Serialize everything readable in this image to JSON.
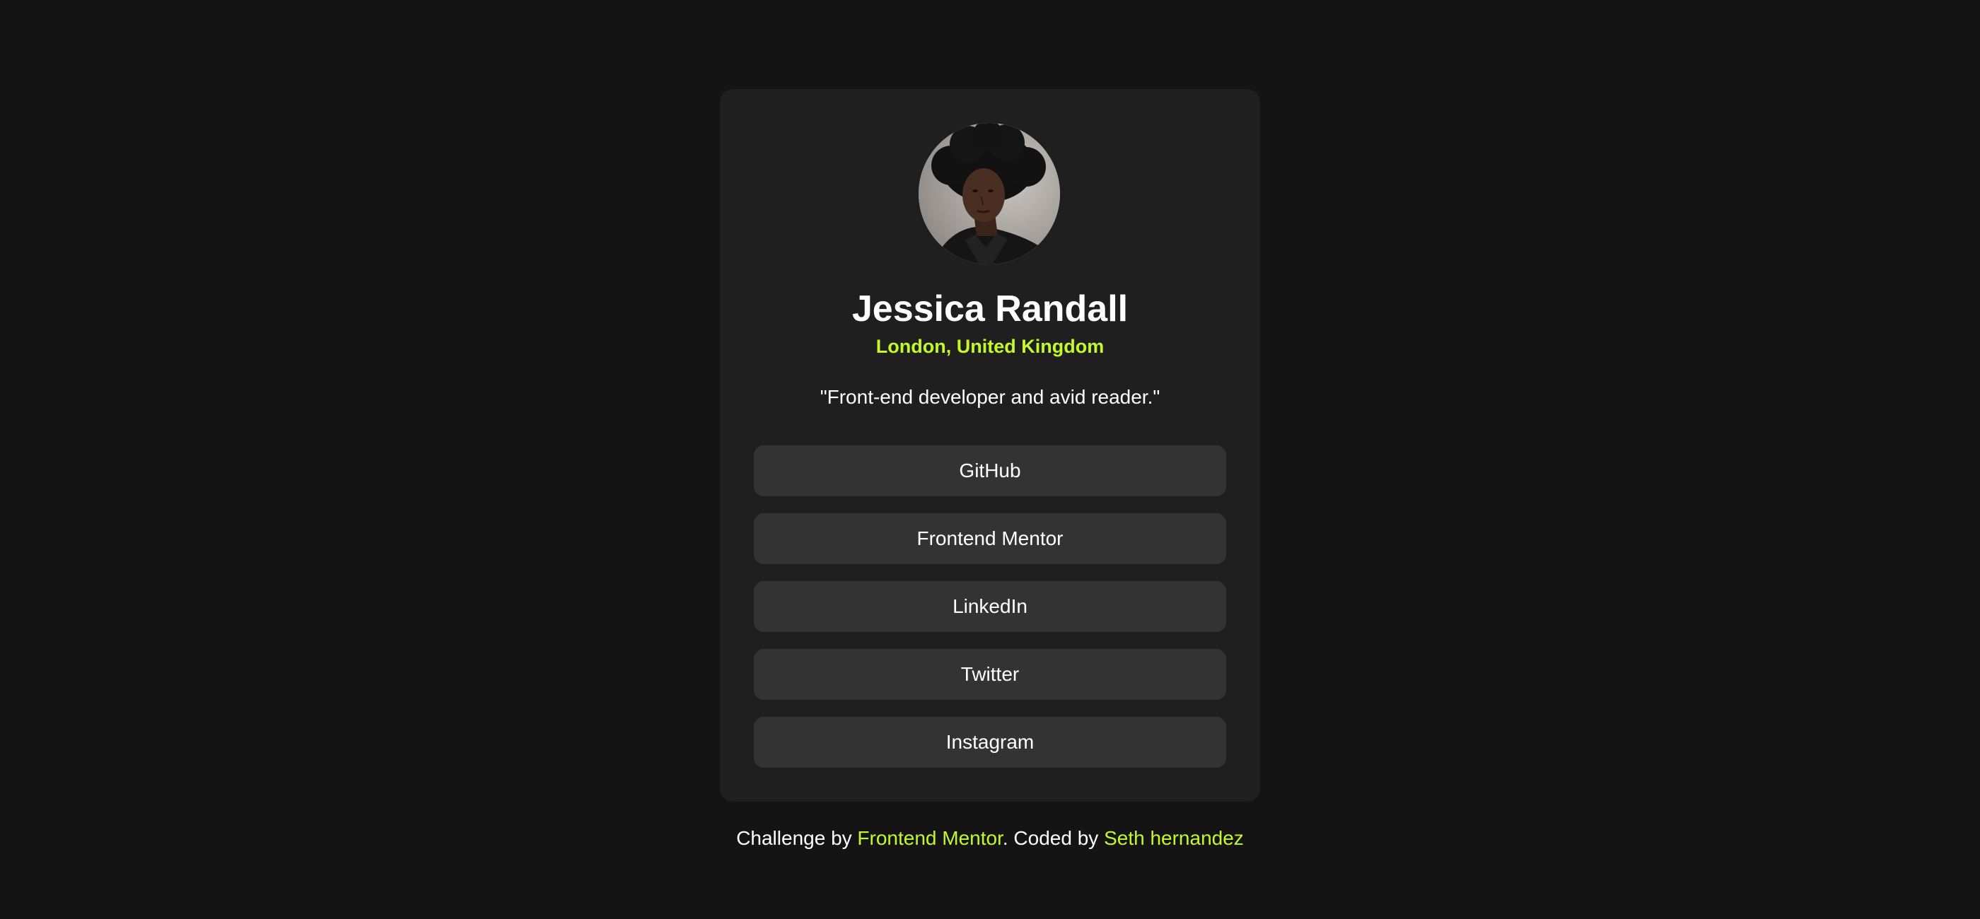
{
  "profile": {
    "name": "Jessica Randall",
    "location": "London, United Kingdom",
    "bio": "\"Front-end developer and avid reader.\""
  },
  "links": [
    {
      "label": "GitHub"
    },
    {
      "label": "Frontend Mentor"
    },
    {
      "label": "LinkedIn"
    },
    {
      "label": "Twitter"
    },
    {
      "label": "Instagram"
    }
  ],
  "footer": {
    "prefix": "Challenge by ",
    "challenge_link": "Frontend Mentor",
    "middle": ". Coded by ",
    "author_link": "Seth hernandez"
  },
  "colors": {
    "background": "#141414",
    "card": "#1f1f1f",
    "button": "#333333",
    "accent": "#c4f82a",
    "text": "#ffffff"
  }
}
